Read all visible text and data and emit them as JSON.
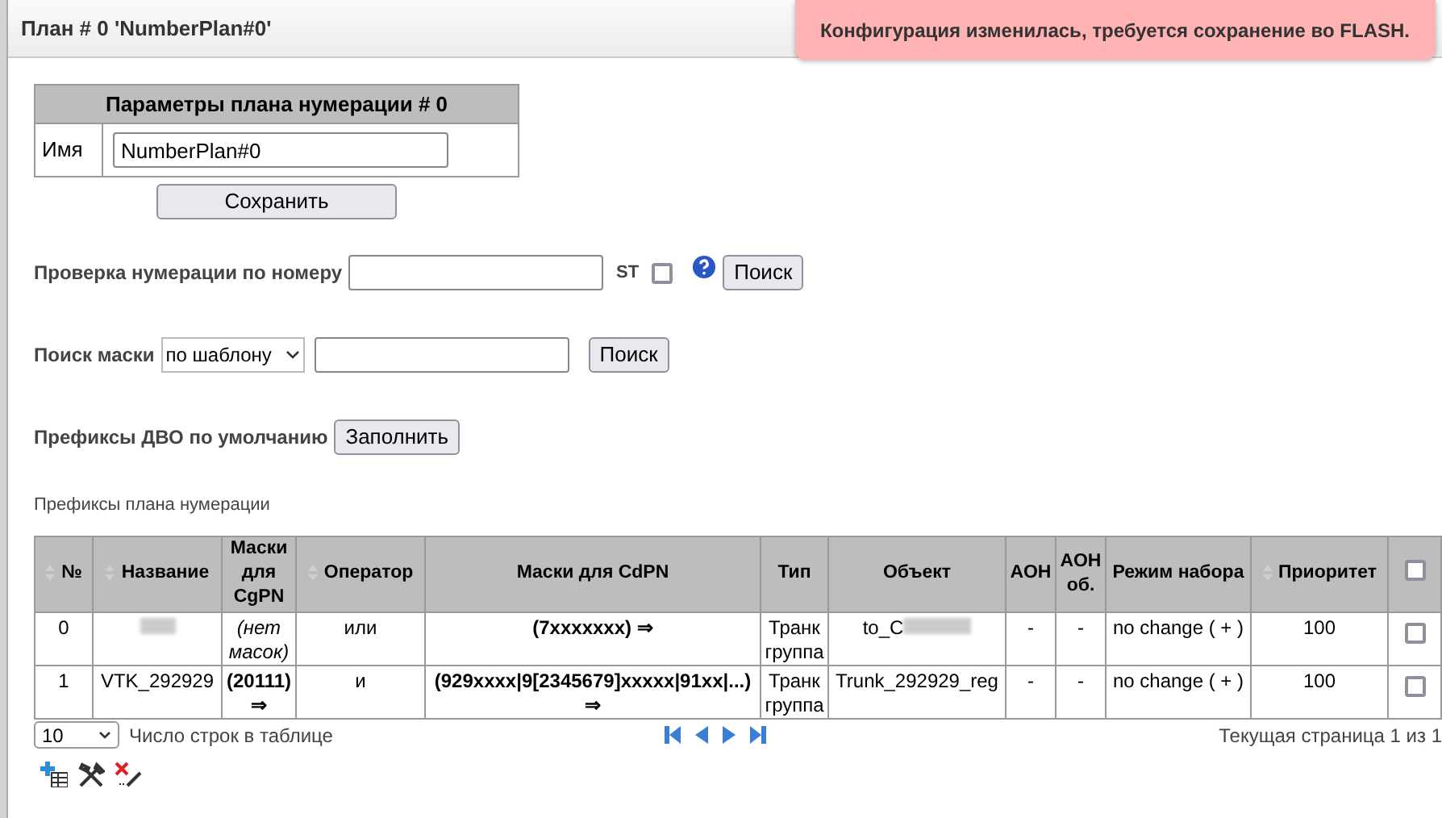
{
  "header": {
    "title": "План # 0 'NumberPlan#0'"
  },
  "toast": {
    "text": "Конфигурация изменилась, требуется сохранение во FLASH."
  },
  "params": {
    "title": "Параметры плана нумерации # 0",
    "name_label": "Имя",
    "name_value": "NumberPlan#0",
    "save_button": "Сохранить"
  },
  "check": {
    "label": "Проверка нумерации по номеру",
    "st_label": "ST",
    "st_checked": false,
    "button": "Поиск"
  },
  "mask_search": {
    "label": "Поиск маски",
    "mode": "по шаблону",
    "button": "Поиск"
  },
  "dvo": {
    "label": "Префиксы ДВО по умолчанию",
    "button": "Заполнить"
  },
  "table": {
    "caption": "Префиксы плана нумерации",
    "columns": [
      {
        "label": "№",
        "sortable": true
      },
      {
        "label": "Название",
        "sortable": true
      },
      {
        "label": "Маски для CgPN",
        "sortable": false
      },
      {
        "label": "Оператор",
        "sortable": true
      },
      {
        "label": "Маски для CdPN",
        "sortable": false
      },
      {
        "label": "Тип",
        "sortable": false
      },
      {
        "label": "Объект",
        "sortable": false
      },
      {
        "label": "АОН",
        "sortable": false
      },
      {
        "label": "АОН об.",
        "sortable": false
      },
      {
        "label": "Режим набора",
        "sortable": false
      },
      {
        "label": "Приоритет",
        "sortable": true
      }
    ],
    "select_all_checked": false,
    "rows": [
      {
        "num": "0",
        "cgpn": "(нет масок)",
        "cgpn_empty": true,
        "operator": "или",
        "cdpn": "(7xxxxxxx) ⇒",
        "type": "Транк группа",
        "object": "to_C",
        "aon": "-",
        "aon_ob": "-",
        "mode": "no change ( + )",
        "priority": "100",
        "checked": false
      },
      {
        "num": "1",
        "name": "VTK_292929",
        "cgpn": "(20111) ⇒",
        "cgpn_empty": false,
        "operator": "и",
        "cdpn": "(929xxxx|9[2345679]xxxxx|91xx|...) ⇒",
        "type": "Транк группа",
        "object": "Trunk_292929_reg",
        "aon": "-",
        "aon_ob": "-",
        "mode": "no change ( + )",
        "priority": "100",
        "checked": false
      }
    ],
    "page_size": "10",
    "page_size_label": "Число строк в таблице",
    "page_info": "Текущая страница 1 из 1"
  }
}
